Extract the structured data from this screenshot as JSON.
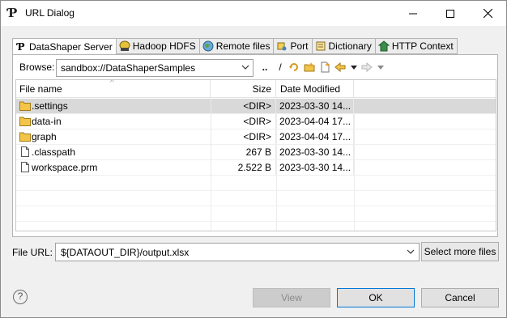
{
  "window": {
    "title": "URL Dialog"
  },
  "tabs": [
    {
      "label": "DataShaper Server",
      "icon": "datashaper-icon"
    },
    {
      "label": "Hadoop HDFS",
      "icon": "hdfs-icon"
    },
    {
      "label": "Remote files",
      "icon": "globe-icon"
    },
    {
      "label": "Port",
      "icon": "port-icon"
    },
    {
      "label": "Dictionary",
      "icon": "dictionary-icon"
    },
    {
      "label": "HTTP Context",
      "icon": "http-icon"
    }
  ],
  "browse": {
    "label": "Browse:",
    "value": "sandbox://DataShaperSamples",
    "toolbar": [
      "..",
      "/"
    ]
  },
  "table": {
    "headers": {
      "name": "File name",
      "size": "Size",
      "modified": "Date Modified"
    },
    "rows": [
      {
        "name": ".settings",
        "size": "<DIR>",
        "modified": "2023-03-30 14...",
        "type": "folder"
      },
      {
        "name": "data-in",
        "size": "<DIR>",
        "modified": "2023-04-04 17...",
        "type": "folder"
      },
      {
        "name": "graph",
        "size": "<DIR>",
        "modified": "2023-04-04 17...",
        "type": "folder"
      },
      {
        "name": ".classpath",
        "size": "267 B",
        "modified": "2023-03-30 14...",
        "type": "file"
      },
      {
        "name": "workspace.prm",
        "size": "2.522 B",
        "modified": "2023-03-30 14...",
        "type": "file"
      }
    ]
  },
  "file_url": {
    "label": "File URL:",
    "value": "${DATAOUT_DIR}/output.xlsx",
    "select_more_label": "Select more files"
  },
  "buttons": {
    "view": "View",
    "ok": "OK",
    "cancel": "Cancel"
  },
  "help_glyph": "?",
  "colors": {
    "folder": "#e8b830",
    "accent": "#0078d7",
    "selected_row": "#d9d9d9"
  }
}
